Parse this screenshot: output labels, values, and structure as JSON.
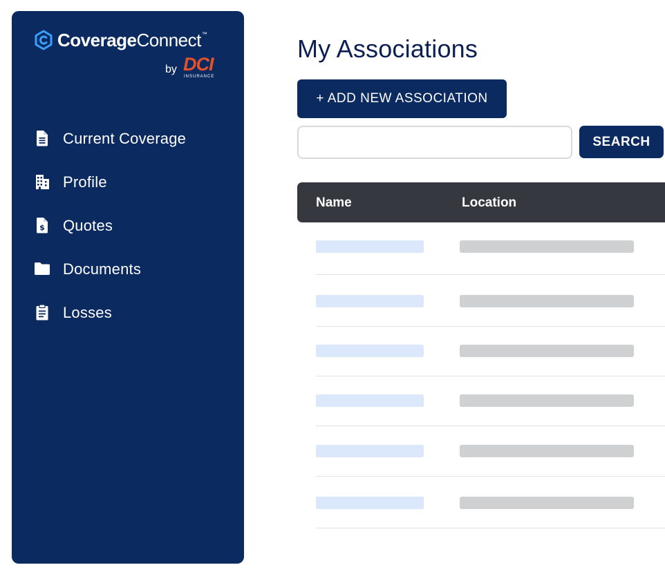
{
  "brand": {
    "name_bold": "Coverage",
    "name_light": "Connect",
    "trademark": "™",
    "by": "by",
    "partner": "DCI",
    "partner_sub": "INSURANCE",
    "colors": {
      "sidebar": "#0b2a60",
      "accent_logo": "#3aa0ff",
      "partner": "#e3522a"
    }
  },
  "sidebar": {
    "items": [
      {
        "label": "Current Coverage",
        "icon": "document-icon"
      },
      {
        "label": "Profile",
        "icon": "building-icon"
      },
      {
        "label": "Quotes",
        "icon": "dollar-document-icon"
      },
      {
        "label": "Documents",
        "icon": "folder-icon"
      },
      {
        "label": "Losses",
        "icon": "clipboard-icon"
      }
    ]
  },
  "main": {
    "title": "My Associations",
    "add_button": "+ ADD NEW ASSOCIATION",
    "search": {
      "value": "",
      "placeholder": "",
      "button": "SEARCH"
    },
    "table": {
      "columns": [
        "Name",
        "Location"
      ],
      "rows_loading": 6
    }
  }
}
